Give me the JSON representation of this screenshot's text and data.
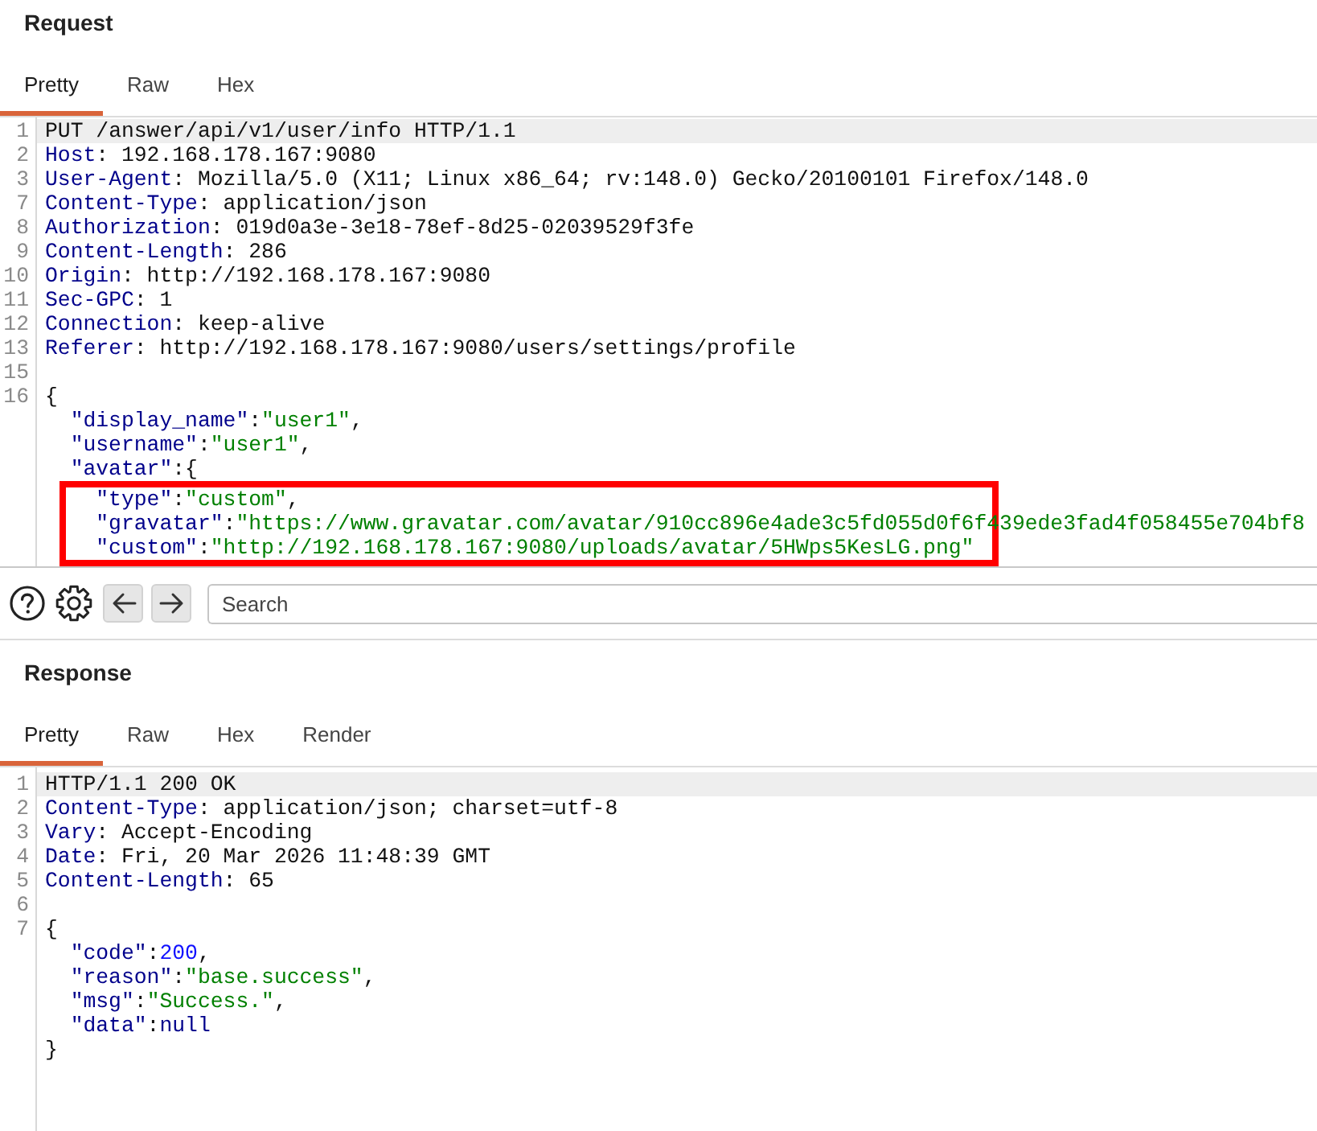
{
  "request": {
    "title": "Request",
    "tabs": [
      {
        "label": "Pretty",
        "selected": true
      },
      {
        "label": "Raw",
        "selected": false
      },
      {
        "label": "Hex",
        "selected": false
      }
    ],
    "lines": [
      {
        "number": "1",
        "highlighted": true,
        "tokens": [
          {
            "kind": "plain",
            "text": "PUT /answer/api/v1/user/info HTTP/1.1"
          }
        ]
      },
      {
        "number": "2",
        "highlighted": false,
        "tokens": [
          {
            "kind": "header",
            "text": "Host"
          },
          {
            "kind": "plain",
            "text": ": 192.168.178.167:9080"
          }
        ]
      },
      {
        "number": "3",
        "highlighted": false,
        "tokens": [
          {
            "kind": "header",
            "text": "User-Agent"
          },
          {
            "kind": "plain",
            "text": ": Mozilla/5.0 (X11; Linux x86_64; rv:148.0) Gecko/20100101 Firefox/148.0"
          }
        ]
      },
      {
        "number": "7",
        "highlighted": false,
        "tokens": [
          {
            "kind": "header",
            "text": "Content-Type"
          },
          {
            "kind": "plain",
            "text": ": application/json"
          }
        ]
      },
      {
        "number": "8",
        "highlighted": false,
        "tokens": [
          {
            "kind": "header",
            "text": "Authorization"
          },
          {
            "kind": "plain",
            "text": ": 019d0a3e-3e18-78ef-8d25-02039529f3fe"
          }
        ]
      },
      {
        "number": "9",
        "highlighted": false,
        "tokens": [
          {
            "kind": "header",
            "text": "Content-Length"
          },
          {
            "kind": "plain",
            "text": ": 286"
          }
        ]
      },
      {
        "number": "10",
        "highlighted": false,
        "tokens": [
          {
            "kind": "header",
            "text": "Origin"
          },
          {
            "kind": "plain",
            "text": ": http://192.168.178.167:9080"
          }
        ]
      },
      {
        "number": "11",
        "highlighted": false,
        "tokens": [
          {
            "kind": "header",
            "text": "Sec-GPC"
          },
          {
            "kind": "plain",
            "text": ": 1"
          }
        ]
      },
      {
        "number": "12",
        "highlighted": false,
        "tokens": [
          {
            "kind": "header",
            "text": "Connection"
          },
          {
            "kind": "plain",
            "text": ": keep-alive"
          }
        ]
      },
      {
        "number": "13",
        "highlighted": false,
        "tokens": [
          {
            "kind": "header",
            "text": "Referer"
          },
          {
            "kind": "plain",
            "text": ": http://192.168.178.167:9080/users/settings/profile"
          }
        ]
      },
      {
        "number": "15",
        "highlighted": false
      },
      {
        "number": "16",
        "highlighted": false,
        "boxed": false,
        "tokens": [
          {
            "kind": "punct",
            "text": "{"
          }
        ],
        "children": [
          {
            "highlighted": false,
            "tokens": [
              {
                "kind": "key",
                "text": "\"display_name\""
              },
              {
                "kind": "punct",
                "text": ":"
              },
              {
                "kind": "string",
                "text": "\"user1\""
              },
              {
                "kind": "punct",
                "text": ","
              }
            ]
          },
          {
            "highlighted": false,
            "tokens": [
              {
                "kind": "key",
                "text": "\"username\""
              },
              {
                "kind": "punct",
                "text": ":"
              },
              {
                "kind": "string",
                "text": "\"user1\""
              },
              {
                "kind": "punct",
                "text": ","
              }
            ]
          },
          {
            "highlighted": false,
            "boxed": true,
            "tokens": [
              {
                "kind": "key",
                "text": "\"avatar\""
              },
              {
                "kind": "punct",
                "text": ":{"
              }
            ],
            "children": [
              {
                "highlighted": false,
                "tokens": [
                  {
                    "kind": "key",
                    "text": "\"type\""
                  },
                  {
                    "kind": "punct",
                    "text": ":"
                  },
                  {
                    "kind": "string",
                    "text": "\"custom\""
                  },
                  {
                    "kind": "punct",
                    "text": ","
                  }
                ]
              },
              {
                "highlighted": false,
                "tokens": [
                  {
                    "kind": "key",
                    "text": "\"gravatar\""
                  },
                  {
                    "kind": "punct",
                    "text": ":"
                  },
                  {
                    "kind": "string",
                    "text": "\"https://www.gravatar.com/avatar/910cc896e4ade3c5fd055d0f6f439ede3fad4f058455e704bf8"
                  }
                ]
              },
              {
                "highlighted": false,
                "tokens": [
                  {
                    "kind": "key",
                    "text": "\"custom\""
                  },
                  {
                    "kind": "punct",
                    "text": ":"
                  },
                  {
                    "kind": "string",
                    "text": "\"http://192.168.178.167:9080/uploads/avatar/5HWps5KesLG.png\""
                  }
                ]
              }
            ]
          }
        ]
      }
    ]
  },
  "toolbar": {
    "search": {
      "placeholder": "Search"
    }
  },
  "response": {
    "title": "Response",
    "tabs": [
      {
        "label": "Pretty",
        "selected": true
      },
      {
        "label": "Raw",
        "selected": false
      },
      {
        "label": "Hex",
        "selected": false
      },
      {
        "label": "Render",
        "selected": false
      }
    ],
    "lines": [
      {
        "number": "1",
        "highlighted": true,
        "tokens": [
          {
            "kind": "plain",
            "text": "HTTP/1.1 200 OK"
          }
        ]
      },
      {
        "number": "2",
        "highlighted": false,
        "tokens": [
          {
            "kind": "header",
            "text": "Content-Type"
          },
          {
            "kind": "plain",
            "text": ": application/json; charset=utf-8"
          }
        ]
      },
      {
        "number": "3",
        "highlighted": false,
        "tokens": [
          {
            "kind": "header",
            "text": "Vary"
          },
          {
            "kind": "plain",
            "text": ": Accept-Encoding"
          }
        ]
      },
      {
        "number": "4",
        "highlighted": false,
        "tokens": [
          {
            "kind": "header",
            "text": "Date"
          },
          {
            "kind": "plain",
            "text": ": Fri, 20 Mar 2026 11:48:39 GMT"
          }
        ]
      },
      {
        "number": "5",
        "highlighted": false,
        "tokens": [
          {
            "kind": "header",
            "text": "Content-Length"
          },
          {
            "kind": "plain",
            "text": ": 65"
          }
        ]
      },
      {
        "number": "6",
        "highlighted": false
      },
      {
        "number": "7",
        "highlighted": false,
        "boxed": false,
        "tokens": [
          {
            "kind": "punct",
            "text": "{"
          }
        ],
        "children": [
          {
            "highlighted": false,
            "tokens": [
              {
                "kind": "key",
                "text": "\"code\""
              },
              {
                "kind": "punct",
                "text": ":"
              },
              {
                "kind": "number",
                "text": "200"
              },
              {
                "kind": "punct",
                "text": ","
              }
            ]
          },
          {
            "highlighted": false,
            "tokens": [
              {
                "kind": "key",
                "text": "\"reason\""
              },
              {
                "kind": "punct",
                "text": ":"
              },
              {
                "kind": "string",
                "text": "\"base.success\""
              },
              {
                "kind": "punct",
                "text": ","
              }
            ]
          },
          {
            "highlighted": false,
            "tokens": [
              {
                "kind": "key",
                "text": "\"msg\""
              },
              {
                "kind": "punct",
                "text": ":"
              },
              {
                "kind": "string",
                "text": "\"Success.\""
              },
              {
                "kind": "punct",
                "text": ","
              }
            ]
          },
          {
            "highlighted": false,
            "tokens": [
              {
                "kind": "key",
                "text": "\"data\""
              },
              {
                "kind": "punct",
                "text": ":"
              },
              {
                "kind": "literal",
                "text": "null"
              }
            ]
          }
        ]
      },
      {
        "highlighted": false,
        "tokens": [
          {
            "kind": "punct",
            "text": "}"
          }
        ]
      }
    ]
  }
}
